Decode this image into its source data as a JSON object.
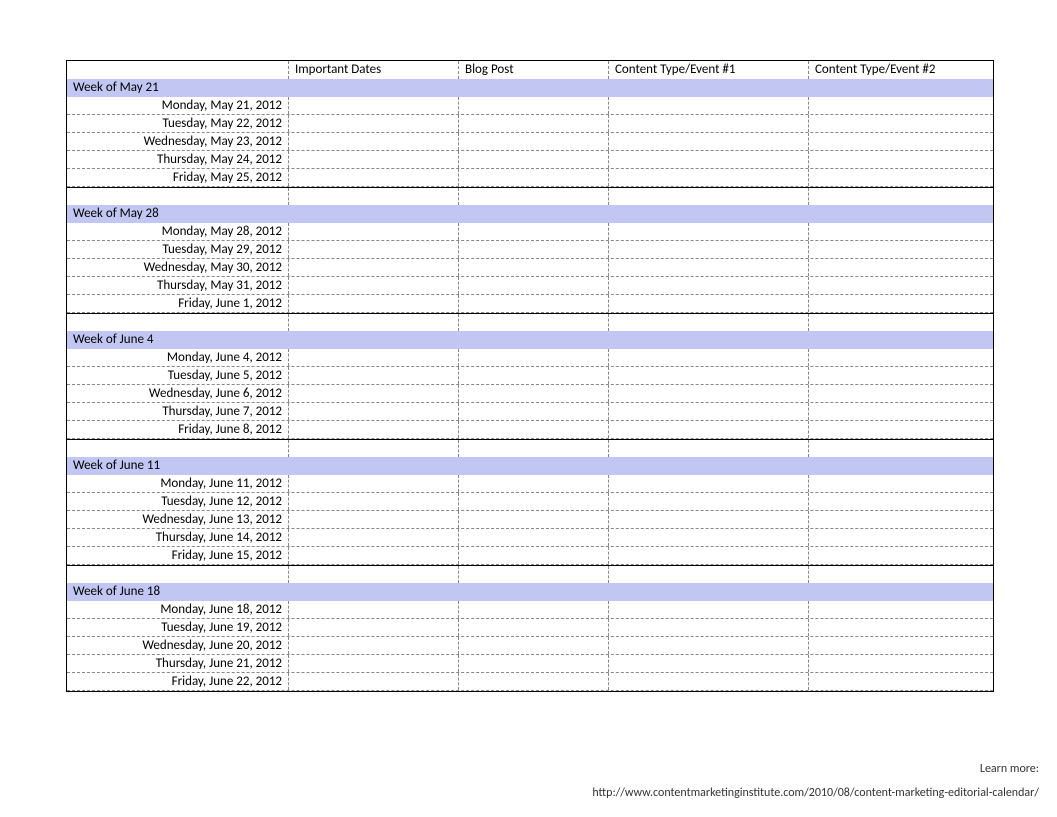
{
  "headers": {
    "c1": "",
    "c2": "Important Dates",
    "c3": "Blog Post",
    "c4": "Content Type/Event #1",
    "c5": "Content Type/Event #2"
  },
  "weeks": [
    {
      "label": "Week of May 21",
      "days": [
        "Monday, May 21, 2012",
        "Tuesday, May 22, 2012",
        "Wednesday, May 23, 2012",
        "Thursday, May 24, 2012",
        "Friday, May 25, 2012"
      ]
    },
    {
      "label": "Week of May 28",
      "days": [
        "Monday, May 28, 2012",
        "Tuesday, May 29, 2012",
        "Wednesday, May 30, 2012",
        "Thursday, May 31, 2012",
        "Friday, June 1, 2012"
      ]
    },
    {
      "label": "Week of June 4",
      "days": [
        "Monday, June 4, 2012",
        "Tuesday, June 5, 2012",
        "Wednesday, June 6, 2012",
        "Thursday, June 7, 2012",
        "Friday, June 8, 2012"
      ]
    },
    {
      "label": "Week of June 11",
      "days": [
        "Monday, June 11, 2012",
        "Tuesday, June 12, 2012",
        "Wednesday, June 13, 2012",
        "Thursday, June 14, 2012",
        "Friday, June 15, 2012"
      ]
    },
    {
      "label": "Week of June 18",
      "days": [
        "Monday, June 18, 2012",
        "Tuesday, June 19, 2012",
        "Wednesday, June 20, 2012",
        "Thursday, June 21, 2012",
        "Friday, June 22, 2012"
      ]
    }
  ],
  "footer": {
    "learn_more": "Learn more:",
    "url": "http://www.contentmarketinginstitute.com/2010/08/content-marketing-editorial-calendar/"
  }
}
